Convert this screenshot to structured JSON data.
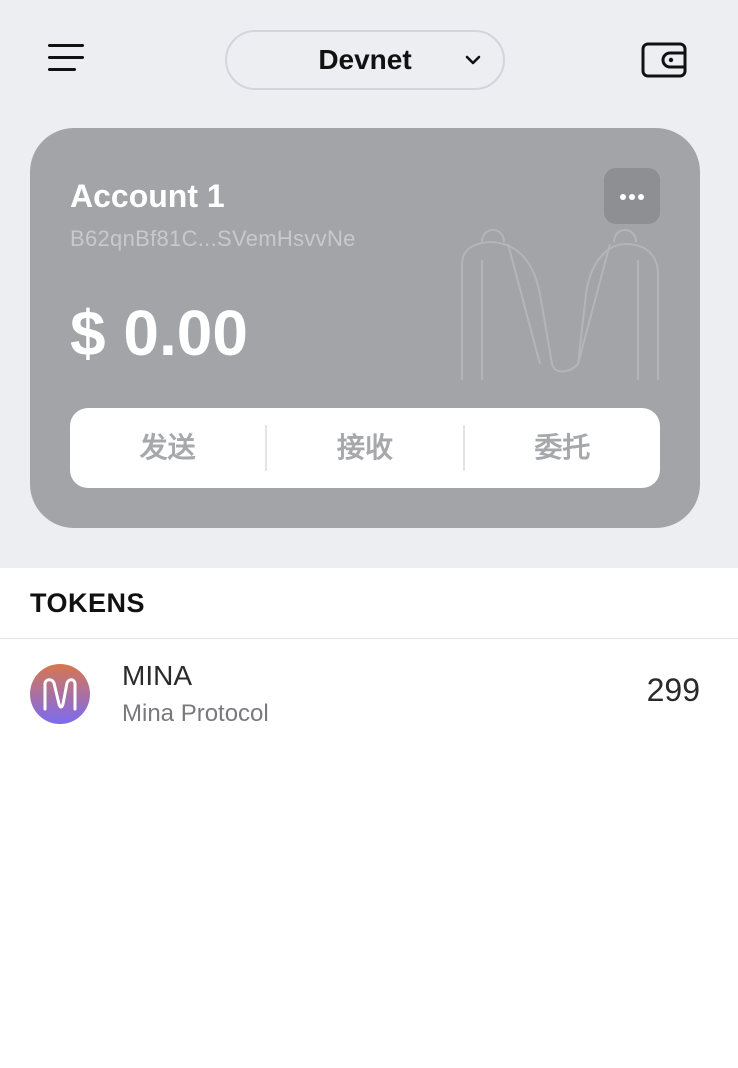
{
  "header": {
    "network": "Devnet"
  },
  "account": {
    "name": "Account 1",
    "address": "B62qnBf81C...SVemHsvvNe",
    "balance": "$ 0.00",
    "actions": [
      {
        "label": "发送"
      },
      {
        "label": "接收"
      },
      {
        "label": "委托"
      }
    ]
  },
  "tokens": {
    "title": "TOKENS",
    "items": [
      {
        "symbol": "MINA",
        "name": "Mina Protocol",
        "amount": "299",
        "icon": "mina-logo-icon"
      }
    ]
  },
  "colors": {
    "background": "#edeef2",
    "card": "#a3a4a7",
    "card_button": "#8e8f92",
    "action_text": "#a7a8ab",
    "logo_gradient_top": "#d8764f",
    "logo_gradient_bottom": "#7b6bf2"
  }
}
